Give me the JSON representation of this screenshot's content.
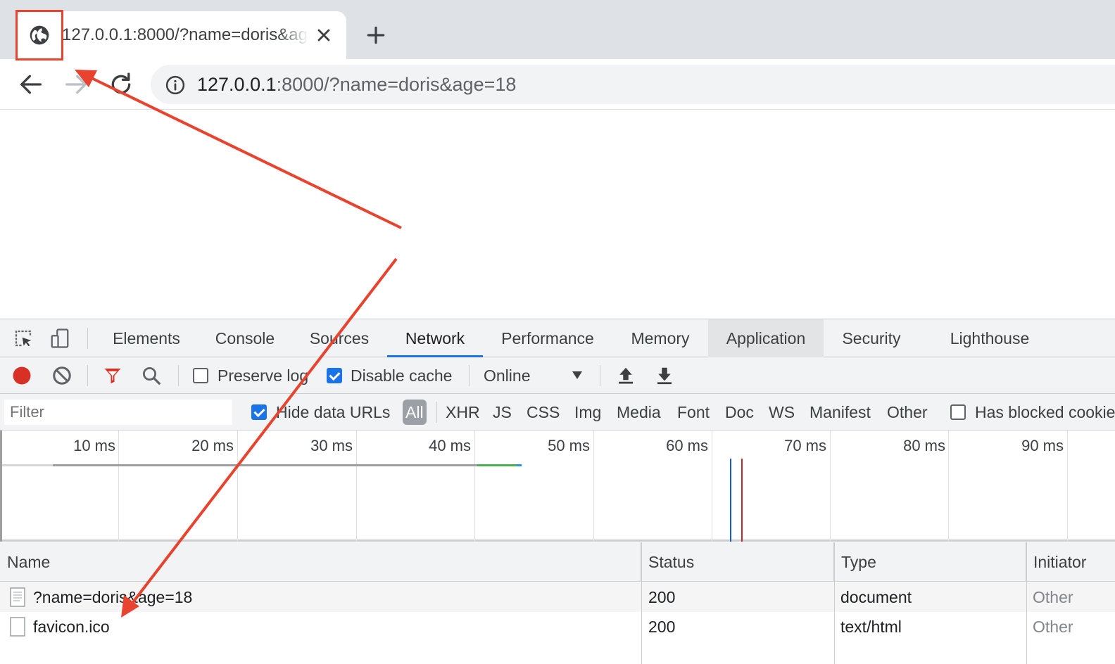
{
  "browser": {
    "tab": {
      "title": "127.0.0.1:8000/?name=doris&age=18",
      "favicon": "globe-icon",
      "close": "close-icon"
    },
    "new_tab": "plus-icon",
    "nav": {
      "back": "back-arrow-icon",
      "forward": "forward-arrow-icon",
      "reload": "reload-icon"
    },
    "address_bar": {
      "info_icon": "info-icon",
      "host": "127.0.0.1",
      "rest": ":8000/?name=doris&age=18"
    }
  },
  "devtools": {
    "tabs": [
      {
        "label": "Elements"
      },
      {
        "label": "Console"
      },
      {
        "label": "Sources"
      },
      {
        "label": "Network"
      },
      {
        "label": "Performance"
      },
      {
        "label": "Memory"
      },
      {
        "label": "Application"
      },
      {
        "label": "Security"
      },
      {
        "label": "Lighthouse"
      }
    ],
    "active_tab": "Network",
    "network_toolbar": {
      "preserve_log": {
        "label": "Preserve log",
        "checked": false
      },
      "disable_cache": {
        "label": "Disable cache",
        "checked": true
      },
      "throttling": "Online"
    },
    "filter": {
      "placeholder": "Filter",
      "hide_data_urls": {
        "label": "Hide data URLs",
        "checked": true
      },
      "types": [
        "All",
        "XHR",
        "JS",
        "CSS",
        "Img",
        "Media",
        "Font",
        "Doc",
        "WS",
        "Manifest",
        "Other"
      ],
      "selected_type": "All",
      "has_blocked_cookies": {
        "label": "Has blocked cookies",
        "checked": false
      }
    },
    "overview": {
      "ticks": [
        "10 ms",
        "20 ms",
        "30 ms",
        "40 ms",
        "50 ms",
        "60 ms",
        "70 ms",
        "80 ms",
        "90 ms"
      ],
      "colors": {
        "waiting": "#9e9e9e",
        "receive": "#4caf50",
        "dcl": "#1a56db",
        "load": "#c62828"
      }
    },
    "requests": {
      "columns": [
        "Name",
        "Status",
        "Type",
        "Initiator"
      ],
      "rows": [
        {
          "name": "?name=doris&age=18",
          "status": "200",
          "type": "document",
          "initiator": "Other"
        },
        {
          "name": "favicon.ico",
          "status": "200",
          "type": "text/html",
          "initiator": "Other"
        }
      ]
    }
  },
  "annotation_color": "#e8432f"
}
